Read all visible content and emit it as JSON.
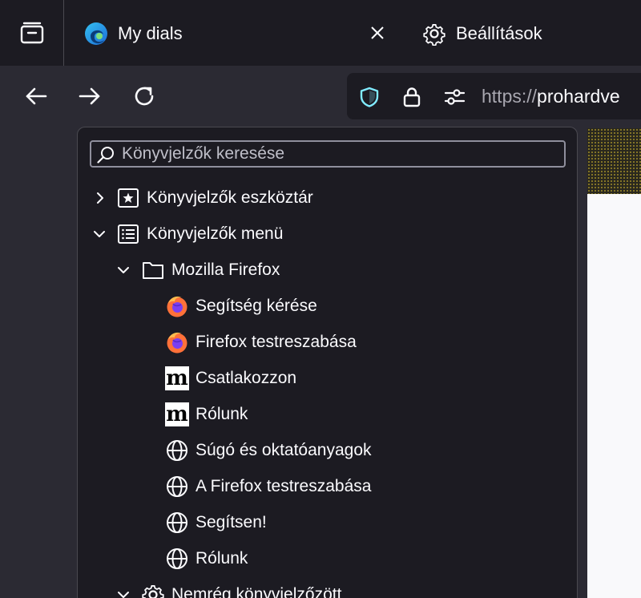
{
  "tabs": {
    "active": {
      "title": "My dials"
    },
    "settings": {
      "title": "Beállítások"
    }
  },
  "urlbar": {
    "scheme": "https://",
    "host": "prohardve"
  },
  "sidebar": {
    "search_placeholder": "Könyvjelzők keresése",
    "items": [
      {
        "label": "Könyvjelzők eszköztár",
        "icon": "bookmarks-toolbar-icon",
        "expanded": false
      },
      {
        "label": "Könyvjelzők menü",
        "icon": "bookmarks-menu-icon",
        "expanded": true
      },
      {
        "label": "Mozilla Firefox",
        "icon": "folder-icon",
        "expanded": true
      },
      {
        "label": "Segítség kérése",
        "icon": "firefox-icon"
      },
      {
        "label": "Firefox testreszabása",
        "icon": "firefox-icon"
      },
      {
        "label": "Csatlakozzon",
        "icon": "mozilla-m-icon"
      },
      {
        "label": "Rólunk",
        "icon": "mozilla-m-icon"
      },
      {
        "label": "Súgó és oktatóanyagok",
        "icon": "globe-icon"
      },
      {
        "label": "A Firefox testreszabása",
        "icon": "globe-icon"
      },
      {
        "label": "Segítsen!",
        "icon": "globe-icon"
      },
      {
        "label": "Rólunk",
        "icon": "globe-icon"
      },
      {
        "label": "Nemrég könyvjelzőzött",
        "icon": "gear-icon",
        "expanded": true
      }
    ]
  },
  "colors": {
    "tabstrip_bg": "#1c1b22",
    "toolbar_bg": "#2b2a33",
    "panel_bg": "#1c1b22",
    "text": "#fbfbfe",
    "shield_accent": "#80ebff"
  }
}
